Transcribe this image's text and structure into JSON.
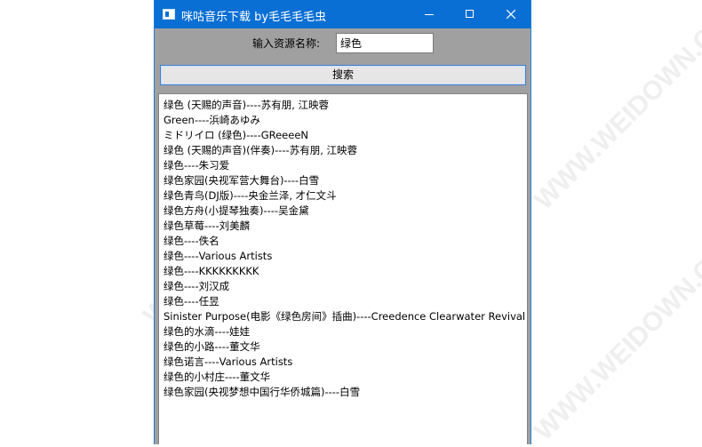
{
  "window": {
    "title": "咪咕音乐下载 by毛毛毛毛虫"
  },
  "form": {
    "label": "输入资源名称:",
    "search_value": "绿色",
    "search_button": "搜索"
  },
  "results": [
    "绿色 (天赐的声音)----苏有朋, 江映蓉",
    "Green----浜崎あゆみ",
    "ミドリイロ (绿色)----GReeeeN",
    "绿色 (天赐的声音)(伴奏)----苏有朋, 江映蓉",
    "绿色----朱习爱",
    "绿色家园(央视军营大舞台)----白雪",
    "绿色青鸟(DJ版)----央金兰泽, 才仁文斗",
    "绿色方舟(小提琴独奏)----吴金黛",
    "绿色草莓----刘美麟",
    "绿色----佚名",
    "绿色----Various Artists",
    "绿色----KKKKKKKKK",
    "绿色----刘汉成",
    "绿色----任昱",
    "Sinister Purpose(电影《绿色房间》插曲)----Creedence Clearwater Revival",
    "绿色的水滴----娃娃",
    "绿色的小路----董文华",
    "绿色诺言----Various Artists",
    "绿色的小村庄----董文华",
    "绿色家园(央视梦想中国行华侨城篇)----白雪"
  ]
}
